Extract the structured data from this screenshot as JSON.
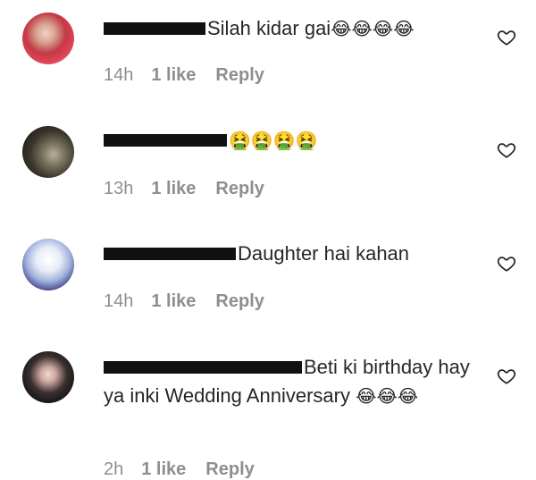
{
  "comments": [
    {
      "text": "Silah kidar gai",
      "emoji": "😂😂😂😂",
      "time": "14h",
      "likes": "1 like",
      "reply": "Reply"
    },
    {
      "text": "",
      "emoji": "🤮🤮🤮🤮",
      "time": "13h",
      "likes": "1 like",
      "reply": "Reply"
    },
    {
      "text": "Daughter hai kahan",
      "emoji": "",
      "time": "14h",
      "likes": "1 like",
      "reply": "Reply"
    },
    {
      "text": "Beti ki birthday hay ya inki Wedding Anniversary",
      "emoji": "😂😂😂",
      "time": "2h",
      "likes": "1 like",
      "reply": "Reply"
    }
  ],
  "colors": {
    "text": "#262626",
    "meta": "#8e8e8e",
    "redaction": "#111111"
  },
  "icons": {
    "like": "heart-outline-icon"
  }
}
